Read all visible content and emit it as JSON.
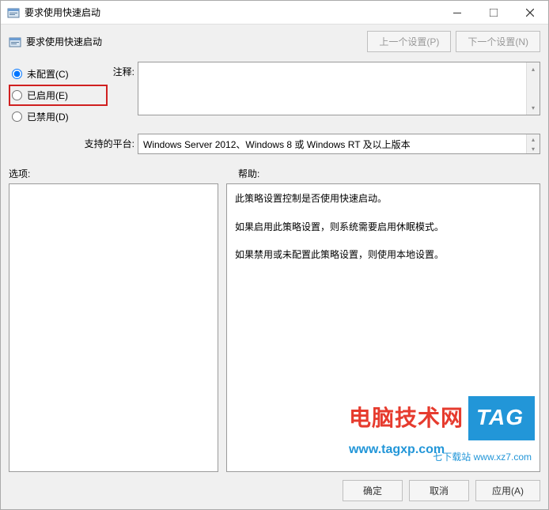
{
  "window": {
    "title": "要求使用快速启动"
  },
  "header": {
    "title": "要求使用快速启动",
    "prev_button": "上一个设置(P)",
    "next_button": "下一个设置(N)"
  },
  "radios": {
    "not_configured": "未配置(C)",
    "enabled": "已启用(E)",
    "disabled": "已禁用(D)"
  },
  "labels": {
    "comment": "注释:",
    "platform": "支持的平台:",
    "options": "选项:",
    "help": "帮助:"
  },
  "platform": {
    "text": "Windows Server 2012、Windows 8 或 Windows RT 及以上版本"
  },
  "help": {
    "p1": "此策略设置控制是否使用快速启动。",
    "p2": "如果启用此策略设置，则系统需要启用休眠模式。",
    "p3": "如果禁用或未配置此策略设置，则使用本地设置。"
  },
  "footer": {
    "ok": "确定",
    "cancel": "取消",
    "apply": "应用(A)"
  },
  "watermark": {
    "brand": "电脑技术网",
    "tag": "TAG",
    "url": "www.tagxp.com",
    "sub": "七下载站",
    "sub_url": "www.xz7.com"
  }
}
